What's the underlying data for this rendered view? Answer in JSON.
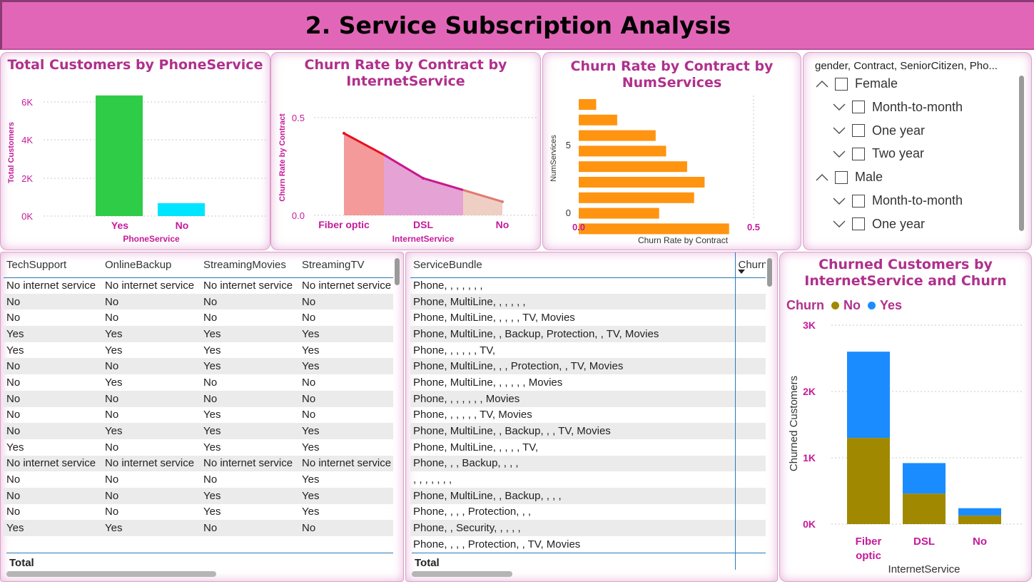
{
  "page_title": "2. Service Subscription Analysis",
  "phone_chart": {
    "title": "Total Customers by PhoneService",
    "ylabel": "Total Customers",
    "xlabel": "PhoneService",
    "yticks": [
      "6K",
      "4K",
      "2K",
      "0K"
    ],
    "categories": [
      "Yes",
      "No"
    ],
    "values": [
      6360,
      680
    ],
    "colors": [
      "#2ecc47",
      "#00e5ff"
    ]
  },
  "internet_churn_chart": {
    "title_line1": "Churn Rate by Contract by",
    "title_line2": "InternetService",
    "ylabel": "Churn Rate by Contract",
    "xlabel": "InternetService",
    "yticks": [
      "0.5",
      "0.0"
    ],
    "categories": [
      "Fiber optic",
      "DSL",
      "No"
    ],
    "values": [
      0.42,
      0.19,
      0.07
    ]
  },
  "numservices_chart": {
    "title_line1": "Churn Rate by Contract by",
    "title_line2": "NumServices",
    "ylabel": "NumServices",
    "xlabel": "Churn Rate by Contract",
    "yticks": [
      "5",
      "0"
    ],
    "xticks": [
      "0.0",
      "0.5"
    ],
    "values": [
      0.05,
      0.11,
      0.22,
      0.25,
      0.31,
      0.36,
      0.33,
      0.23,
      0.43
    ]
  },
  "slicer": {
    "header": "gender, Contract, SeniorCitizen, Pho...",
    "items": [
      {
        "label": "Female",
        "level": 0,
        "expanded": true
      },
      {
        "label": "Month-to-month",
        "level": 1,
        "expanded": false
      },
      {
        "label": "One year",
        "level": 1,
        "expanded": false
      },
      {
        "label": "Two year",
        "level": 1,
        "expanded": false
      },
      {
        "label": "Male",
        "level": 0,
        "expanded": true
      },
      {
        "label": "Month-to-month",
        "level": 1,
        "expanded": false
      },
      {
        "label": "One year",
        "level": 1,
        "expanded": false
      }
    ]
  },
  "support_table": {
    "headers": [
      "TechSupport",
      "OnlineBackup",
      "StreamingMovies",
      "StreamingTV"
    ],
    "rows": [
      [
        "No internet service",
        "No internet service",
        "No internet service",
        "No internet service"
      ],
      [
        "No",
        "No",
        "No",
        "No"
      ],
      [
        "No",
        "No",
        "No",
        "No"
      ],
      [
        "Yes",
        "Yes",
        "Yes",
        "Yes"
      ],
      [
        "Yes",
        "Yes",
        "Yes",
        "Yes"
      ],
      [
        "No",
        "No",
        "Yes",
        "Yes"
      ],
      [
        "No",
        "Yes",
        "No",
        "No"
      ],
      [
        "No",
        "No",
        "No",
        "No"
      ],
      [
        "No",
        "No",
        "Yes",
        "No"
      ],
      [
        "No",
        "Yes",
        "Yes",
        "Yes"
      ],
      [
        "Yes",
        "No",
        "Yes",
        "Yes"
      ],
      [
        "No internet service",
        "No internet service",
        "No internet service",
        "No internet service"
      ],
      [
        "No",
        "No",
        "No",
        "Yes"
      ],
      [
        "No",
        "No",
        "Yes",
        "Yes"
      ],
      [
        "No",
        "No",
        "Yes",
        "Yes"
      ],
      [
        "Yes",
        "Yes",
        "No",
        "No"
      ]
    ],
    "total_label": "Total"
  },
  "bundle_table": {
    "headers": [
      "ServiceBundle",
      "Churn"
    ],
    "rows": [
      "Phone, , , , , , ,",
      "Phone, MultiLine, , , , , ,",
      "Phone, MultiLine, , , , , TV, Movies",
      "Phone, MultiLine, , Backup, Protection, , TV, Movies",
      "Phone, , , , , , TV,",
      "Phone, MultiLine, , , Protection, , TV, Movies",
      "Phone, MultiLine, , , , , , Movies",
      "Phone, , , , , , , Movies",
      "Phone, , , , , , TV, Movies",
      "Phone, MultiLine, , Backup, , , TV, Movies",
      "Phone, MultiLine, , , , , TV,",
      "Phone, , , Backup, , , ,",
      ", , , , , , ,",
      "Phone, MultiLine, , Backup, , , ,",
      "Phone, , , , Protection, , ,",
      "Phone, , Security, , , , ,",
      "Phone, , , , Protection, , TV, Movies"
    ],
    "total_label": "Total"
  },
  "churned_chart": {
    "title_line1": "Churned Customers by",
    "title_line2": "InternetService and Churn",
    "legend_title": "Churn",
    "series": [
      {
        "name": "No",
        "color": "#a08900",
        "values": [
          1300,
          460,
          130
        ]
      },
      {
        "name": "Yes",
        "color": "#1a8cff",
        "values": [
          1300,
          460,
          110
        ]
      }
    ],
    "categories": [
      [
        "Fiber",
        "optic"
      ],
      [
        "DSL"
      ],
      [
        "No"
      ]
    ],
    "yticks": [
      "3K",
      "2K",
      "1K",
      "0K"
    ],
    "ylabel": "Churned Customers",
    "xlabel": "InternetService"
  }
}
